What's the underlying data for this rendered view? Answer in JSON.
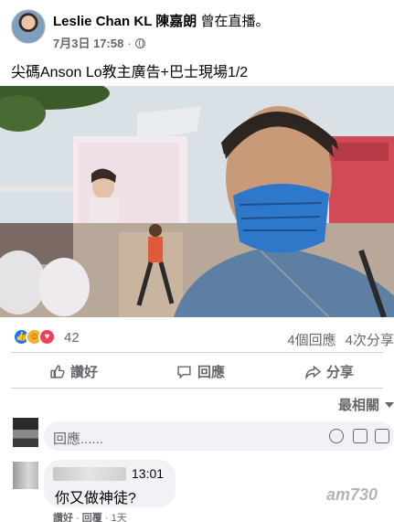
{
  "post": {
    "author": "Leslie Chan KL 陳嘉朗",
    "activity": "曾在直播。",
    "date": "7月3日 17:58",
    "dot": "·",
    "caption": "尖碼Anson Lo教主廣告+巴士現場1/2"
  },
  "reactions": {
    "count": "42",
    "comments": "4個回應",
    "shares": "4次分享"
  },
  "actions": {
    "like": "讚好",
    "comment": "回應",
    "share": "分享"
  },
  "sort": {
    "label": "最相關"
  },
  "composer": {
    "placeholder": "回應......"
  },
  "comment": {
    "time": "13:01",
    "text": "你又做神徒?",
    "like": "讚好",
    "reply": "回覆",
    "age": "1天",
    "sep": "·"
  },
  "watermark": "am730",
  "icons": {
    "privacy": "globe-icon",
    "react_like": "like-reaction-icon",
    "react_haha": "haha-reaction-icon",
    "react_love": "love-reaction-icon"
  }
}
